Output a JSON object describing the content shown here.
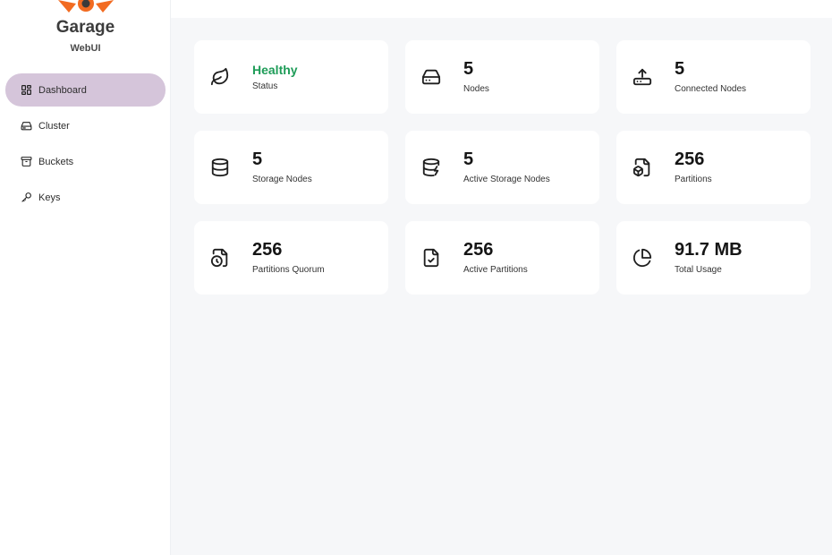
{
  "brand": {
    "title": "Garage",
    "subtitle": "WebUI"
  },
  "colors": {
    "accent": "#d5c5da",
    "healthy": "#1e9c58",
    "logo_orange": "#f26b21",
    "main_bg": "#f6f7f9"
  },
  "sidebar": {
    "items": [
      {
        "label": "Dashboard",
        "icon": "dashboard-icon",
        "active": true
      },
      {
        "label": "Cluster",
        "icon": "hard-drive-icon",
        "active": false
      },
      {
        "label": "Buckets",
        "icon": "archive-icon",
        "active": false
      },
      {
        "label": "Keys",
        "icon": "key-icon",
        "active": false
      }
    ]
  },
  "stats": [
    {
      "value": "Healthy",
      "label": "Status",
      "icon": "leaf-icon"
    },
    {
      "value": "5",
      "label": "Nodes",
      "icon": "hard-drive-icon"
    },
    {
      "value": "5",
      "label": "Connected Nodes",
      "icon": "upload-drive-icon"
    },
    {
      "value": "5",
      "label": "Storage Nodes",
      "icon": "database-icon"
    },
    {
      "value": "5",
      "label": "Active Storage Nodes",
      "icon": "database-zap-icon"
    },
    {
      "value": "256",
      "label": "Partitions",
      "icon": "file-box-icon"
    },
    {
      "value": "256",
      "label": "Partitions Quorum",
      "icon": "file-clock-icon"
    },
    {
      "value": "256",
      "label": "Active Partitions",
      "icon": "file-check-icon"
    },
    {
      "value": "91.7 MB",
      "label": "Total Usage",
      "icon": "pie-chart-icon"
    }
  ]
}
